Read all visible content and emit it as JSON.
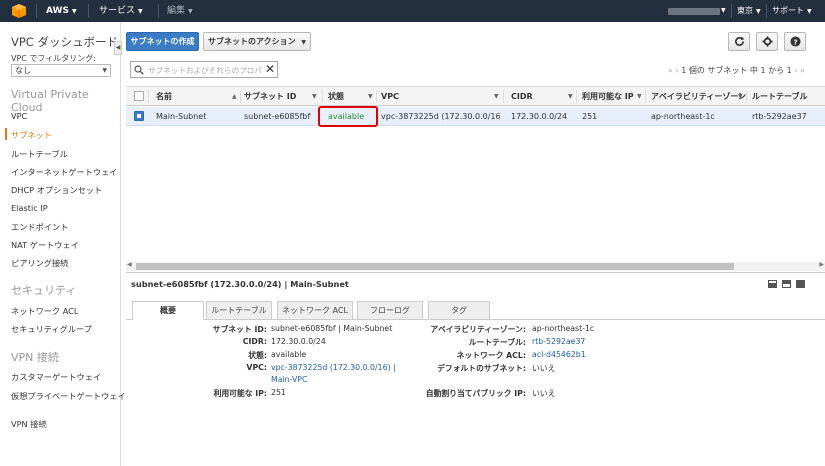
{
  "topnav": {
    "brand": "AWS",
    "services": "サービス",
    "edit": "編集",
    "region": "東京",
    "support": "サポート"
  },
  "sidebar": {
    "title": "VPC ダッシュボード",
    "filter_label": "VPC でフィルタリング:",
    "filter_value": "なし",
    "section_vpc": "Virtual Private Cloud",
    "items_vpc": [
      "VPC",
      "サブネット",
      "ルートテーブル",
      "インターネットゲートウェイ",
      "DHCP オプションセット",
      "Elastic IP",
      "エンドポイント",
      "NAT ゲートウェイ",
      "ピアリング接続"
    ],
    "section_security": "セキュリティ",
    "items_security": [
      "ネットワーク ACL",
      "セキュリティグループ"
    ],
    "section_vpn": "VPN 接続",
    "items_vpn": [
      "カスタマーゲートウェイ",
      "仮想プライベートゲートウェイ",
      "VPN 接続"
    ]
  },
  "toolbar": {
    "create_label": "サブネットの作成",
    "actions_label": "サブネットのアクション"
  },
  "search": {
    "placeholder": "サブネットおよびそれらのプロパ"
  },
  "pager": {
    "text": "1 個の サブネット 中 1 から 1"
  },
  "table": {
    "columns": [
      "名前",
      "サブネット ID",
      "状態",
      "VPC",
      "CIDR",
      "利用可能な IP",
      "アベイラビリティーゾーン",
      "ルートテーブル"
    ],
    "rows": [
      {
        "name": "Main-Subnet",
        "subnet_id": "subnet-e6085fbf",
        "state": "available",
        "vpc": "vpc-3873225d (172.30.0.0/16) | M...",
        "cidr": "172.30.0.0/24",
        "available_ip": "251",
        "az": "ap-northeast-1c",
        "route_table": "rtb-5292ae37"
      }
    ]
  },
  "detail": {
    "title": "subnet-e6085fbf (172.30.0.0/24) | Main-Subnet",
    "tabs": [
      "概要",
      "ルートテーブル",
      "ネットワーク ACL",
      "フローログ",
      "タグ"
    ],
    "left": {
      "subnet_id_label": "サブネット ID:",
      "subnet_id_value": "subnet-e6085fbf | Main-Subnet",
      "cidr_label": "CIDR:",
      "cidr_value": "172.30.0.0/24",
      "state_label": "状態:",
      "state_value": "available",
      "vpc_label": "VPC:",
      "vpc_value_1": "vpc-3873225d (172.30.0.0/16) |",
      "vpc_value_2": "Main-VPC",
      "ip_label": "利用可能な IP:",
      "ip_value": "251"
    },
    "right": {
      "az_label": "アベイラビリティーゾーン:",
      "az_value": "ap-northeast-1c",
      "rt_label": "ルートテーブル:",
      "rt_value": "rtb-5292ae37",
      "acl_label": "ネットワーク ACL:",
      "acl_value": "acl-d45462b1",
      "default_label": "デフォルトのサブネット:",
      "default_value": "いいえ",
      "autoip_label": "自動割り当てパブリック IP:",
      "autoip_value": "いいえ"
    }
  },
  "colors": {
    "nav_bg": "#232f3e",
    "primary": "#3b7cc4",
    "active_orange": "#e47911",
    "status_green": "#2e8b2e",
    "highlight_red": "#e00000",
    "link": "#1f5fa6"
  }
}
